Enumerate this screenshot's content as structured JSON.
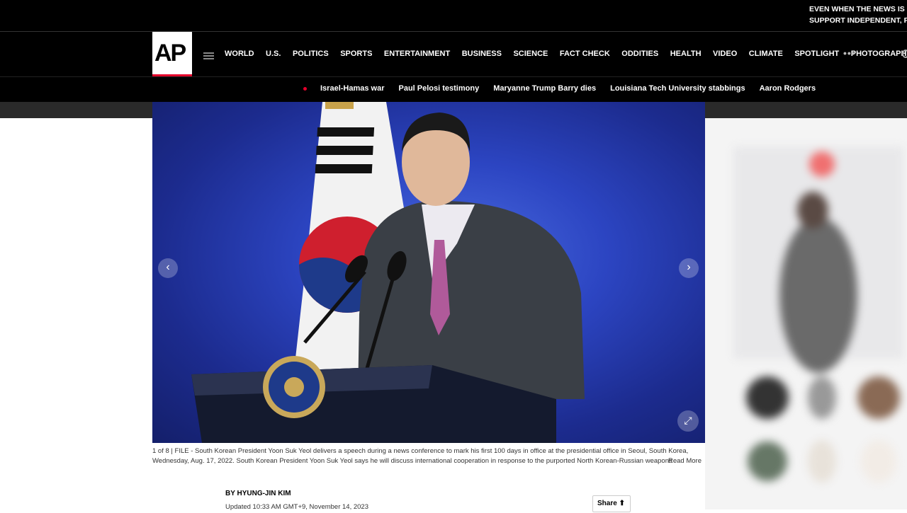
{
  "top_banner": {
    "line1": "EVEN WHEN THE NEWS IS FRE",
    "line2": "SUPPORT INDEPENDENT, FAC"
  },
  "logo_text": "AP",
  "nav": {
    "items": [
      "WORLD",
      "U.S.",
      "POLITICS",
      "SPORTS",
      "ENTERTAINMENT",
      "BUSINESS",
      "SCIENCE",
      "FACT CHECK",
      "ODDITIES",
      "HEALTH",
      "VIDEO",
      "CLIMATE",
      "SPOTLIGHT",
      "PHOTOGRAPHY"
    ],
    "more": "•••"
  },
  "trending": {
    "items": [
      "Israel-Hamas war",
      "Paul Pelosi testimony",
      "Maryanne Trump Barry dies",
      "Louisiana Tech University stabbings",
      "Aaron Rodgers"
    ]
  },
  "gallery": {
    "prev_icon": "‹",
    "next_icon": "›",
    "expand_icon": "⤢"
  },
  "caption": {
    "text": "1 of 8 | FILE - South Korean President Yoon Suk Yeol delivers a speech during a news conference to mark his first 100 days in office at the presidential office in Seoul, South Korea, Wednesday, Aug. 17, 2022. South Korean President Yoon Suk Yeol says he will discuss international cooperation in response to the purported North Korean-Russian weapons",
    "read_more": "Read More"
  },
  "article": {
    "byline": "BY HYUNG-JIN KIM",
    "updated": "Updated 10:33 AM GMT+9, November 14, 2023",
    "share_label": "Share"
  },
  "colors": {
    "accent": "#e4002b",
    "header_bg": "#000000"
  }
}
